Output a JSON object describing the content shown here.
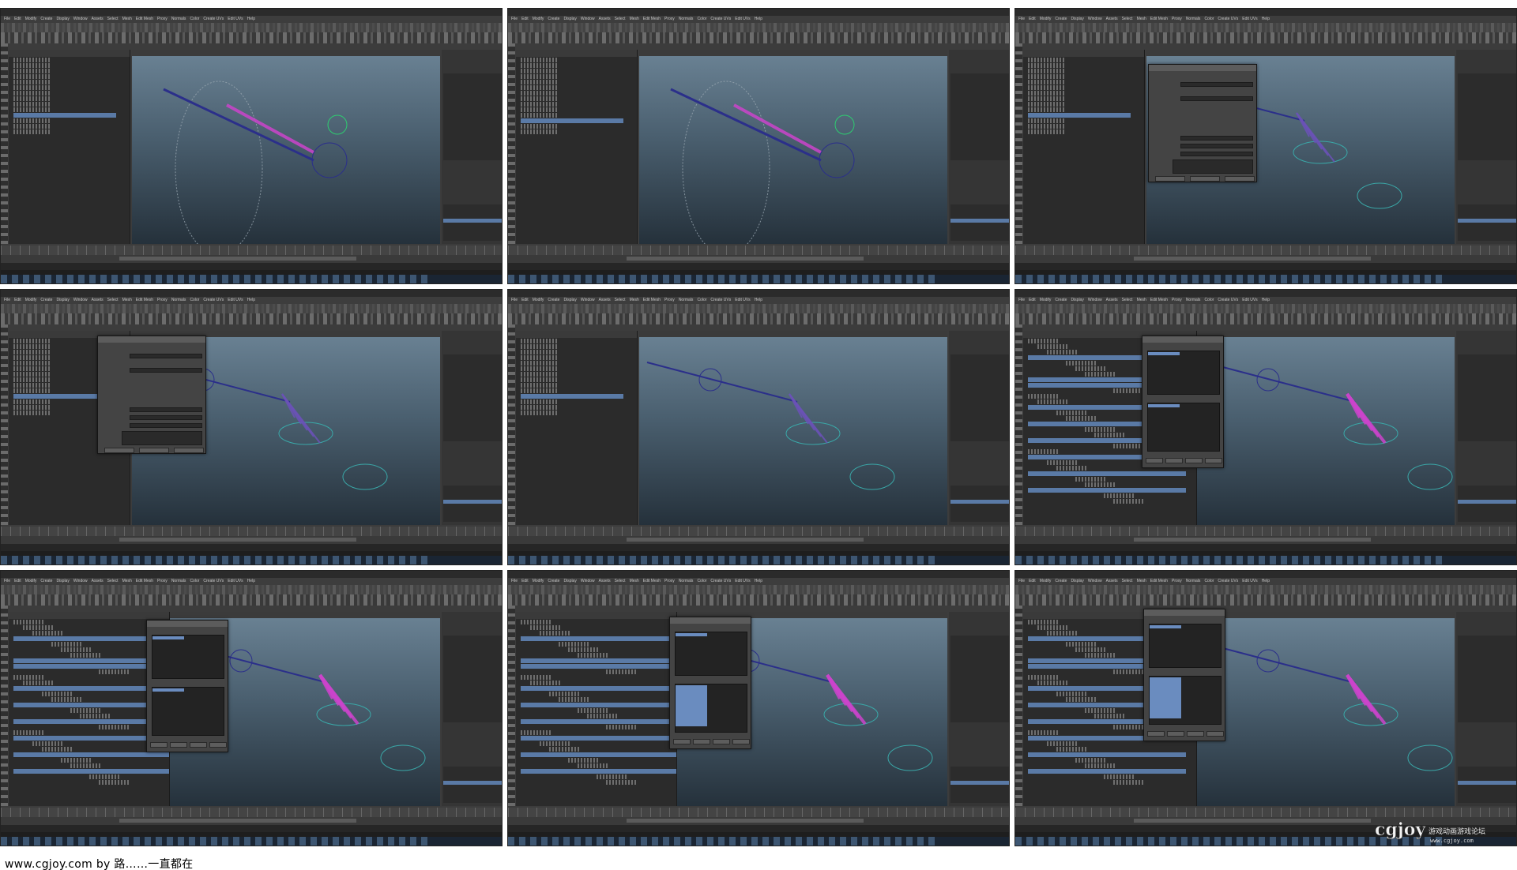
{
  "frames": [
    {
      "id": "frame-1",
      "variant": "outliner",
      "dialog": "none",
      "figure": "left"
    },
    {
      "id": "frame-2",
      "variant": "outliner",
      "dialog": "none",
      "figure": "left"
    },
    {
      "id": "frame-3",
      "variant": "outliner",
      "dialog": "attribute",
      "figure": "hand"
    },
    {
      "id": "frame-4",
      "variant": "outliner",
      "dialog": "attribute-left",
      "figure": "hand"
    },
    {
      "id": "frame-5",
      "variant": "outliner",
      "dialog": "none",
      "figure": "hand"
    },
    {
      "id": "frame-6",
      "variant": "hypergraph",
      "dialog": "driven-key",
      "figure": "hand-pink"
    },
    {
      "id": "frame-7",
      "variant": "hypergraph",
      "dialog": "driven-key",
      "figure": "hand-pink"
    },
    {
      "id": "frame-8",
      "variant": "hypergraph",
      "dialog": "driven-key-list",
      "figure": "hand-pink"
    },
    {
      "id": "frame-9",
      "variant": "hypergraph",
      "dialog": "driven-key-list",
      "figure": "hand-pink-right"
    }
  ],
  "menu_items": [
    "File",
    "Edit",
    "Modify",
    "Create",
    "Display",
    "Window",
    "Assets",
    "Select",
    "Mesh",
    "Edit Mesh",
    "Proxy",
    "Normals",
    "Color",
    "Create UVs",
    "Edit UVs",
    "Help"
  ],
  "colors": {
    "selection": "#5a7aa6",
    "viewport_top": "#6b8395",
    "viewport_bottom": "#25313b",
    "rig_control": "#2b2f8a",
    "pink_joint": "#cc44cc"
  },
  "watermark": {
    "brand": "cgjoy",
    "sub": "www.cgjoy.com"
  },
  "footer": {
    "text": "www.cgjoy.com by 路……一直都在"
  }
}
